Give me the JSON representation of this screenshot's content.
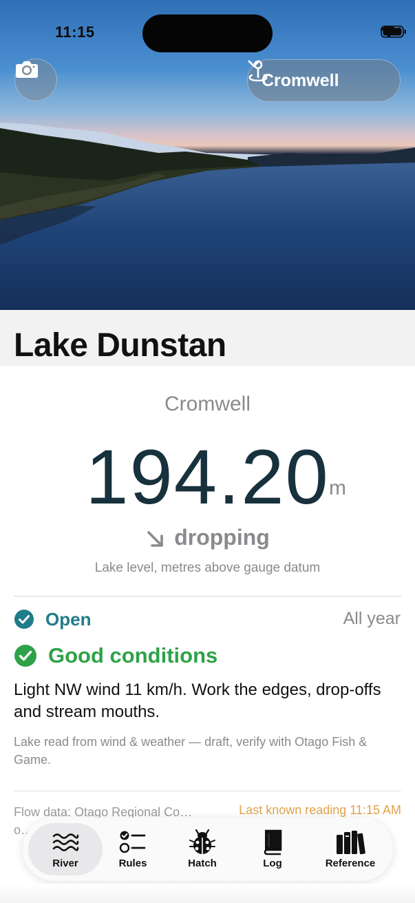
{
  "status_bar": {
    "time": "11:15"
  },
  "header": {
    "location_button_label": "Cromwell",
    "camera_button": "camera-icon",
    "location_icon": "location-pin-icon"
  },
  "page": {
    "title": "Lake Dunstan"
  },
  "reading": {
    "station": "Cromwell",
    "value": "194.20",
    "unit": "m",
    "trend": "dropping",
    "caption": "Lake level, metres above gauge datum"
  },
  "status": {
    "open_label": "Open",
    "season": "All year",
    "conditions_label": "Good conditions",
    "summary": "Light NW wind 11 km/h. Work the edges, drop-offs and stream mouths.",
    "disclaimer": "Lake read from wind & weather — draft, verify with Otago Fish & Game."
  },
  "footer": {
    "source": "Flow data: Otago Regional Co… o…",
    "last_reading": "Last known reading 11:15 AM"
  },
  "tabs": [
    {
      "label": "River",
      "icon": "waves-icon",
      "active": true
    },
    {
      "label": "Rules",
      "icon": "checklist-icon",
      "active": false
    },
    {
      "label": "Hatch",
      "icon": "ladybug-icon",
      "active": false
    },
    {
      "label": "Log",
      "icon": "book-icon",
      "active": false
    },
    {
      "label": "Reference",
      "icon": "books-icon",
      "active": false
    }
  ],
  "colors": {
    "open": "#1f7c89",
    "good": "#2ea248",
    "level": "#17313d",
    "last_reading": "#e0a24a"
  }
}
